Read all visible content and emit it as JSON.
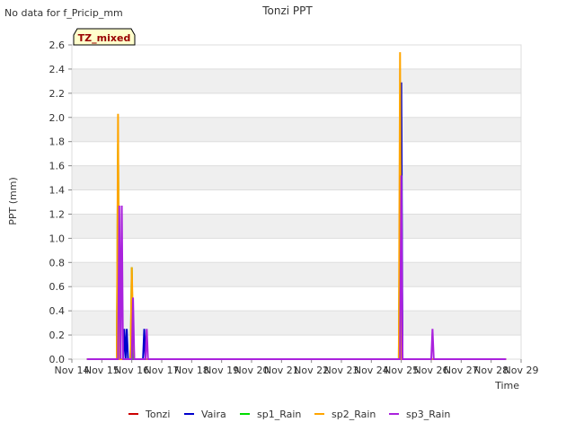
{
  "page": {
    "nodata_note": "No data for f_Pricip_mm"
  },
  "chart_data": {
    "type": "line",
    "title": "Tonzi PPT",
    "xlabel": "Time",
    "ylabel": "PPT (mm)",
    "badge": "TZ_mixed",
    "xlim": [
      "2016-11-14",
      "2016-11-29"
    ],
    "ylim": [
      0,
      2.6
    ],
    "yticks": [
      "0.0",
      "0.2",
      "0.4",
      "0.6",
      "0.8",
      "1.0",
      "1.2",
      "1.4",
      "1.6",
      "1.8",
      "2.0",
      "2.2",
      "2.4",
      "2.6"
    ],
    "xticks": [
      "Nov 14",
      "Nov 15",
      "Nov 16",
      "Nov 17",
      "Nov 18",
      "Nov 19",
      "Nov 20",
      "Nov 21",
      "Nov 22",
      "Nov 23",
      "Nov 24",
      "Nov 25",
      "Nov 26",
      "Nov 27",
      "Nov 28",
      "Nov 29"
    ],
    "grid": true,
    "legend": "bottom",
    "series": [
      {
        "name": "Tonzi",
        "color": "#cc0000",
        "points": [
          [
            "2016-11-14 12:00",
            0
          ],
          [
            "2016-11-15 12:00",
            0
          ],
          [
            "2016-11-15 13:00",
            1.27
          ],
          [
            "2016-11-15 14:00",
            0
          ],
          [
            "2016-11-15 23:00",
            0
          ],
          [
            "2016-11-16 00:00",
            0.51
          ],
          [
            "2016-11-16 01:00",
            0
          ],
          [
            "2016-11-24 23:00",
            0
          ],
          [
            "2016-11-25 00:00",
            0.25
          ],
          [
            "2016-11-25 01:00",
            0
          ],
          [
            "2016-11-28 12:00",
            0
          ]
        ]
      },
      {
        "name": "Vaira",
        "color": "#0000cc",
        "points": [
          [
            "2016-11-14 12:00",
            0
          ],
          [
            "2016-11-15 13:00",
            0
          ],
          [
            "2016-11-15 14:00",
            1.02
          ],
          [
            "2016-11-15 15:00",
            0
          ],
          [
            "2016-11-15 17:00",
            0
          ],
          [
            "2016-11-15 18:00",
            0.25
          ],
          [
            "2016-11-15 19:00",
            0
          ],
          [
            "2016-11-15 20:00",
            0.25
          ],
          [
            "2016-11-15 21:00",
            0
          ],
          [
            "2016-11-16 09:00",
            0
          ],
          [
            "2016-11-16 10:00",
            0.25
          ],
          [
            "2016-11-16 11:00",
            0
          ],
          [
            "2016-11-24 23:00",
            0
          ],
          [
            "2016-11-25 00:00",
            2.29
          ],
          [
            "2016-11-25 01:00",
            0
          ],
          [
            "2016-11-28 12:00",
            0
          ]
        ]
      },
      {
        "name": "sp1_Rain",
        "color": "#00dd00",
        "points": [
          [
            "2016-11-14 12:00",
            0
          ],
          [
            "2016-11-15 12:00",
            0
          ],
          [
            "2016-11-15 13:00",
            1.78
          ],
          [
            "2016-11-15 14:00",
            0
          ],
          [
            "2016-11-15 23:00",
            0
          ],
          [
            "2016-11-16 00:00",
            0.76
          ],
          [
            "2016-11-16 01:00",
            0
          ],
          [
            "2016-11-24 22:00",
            0
          ],
          [
            "2016-11-24 23:00",
            1.52
          ],
          [
            "2016-11-25 00:00",
            0
          ],
          [
            "2016-11-28 12:00",
            0
          ]
        ]
      },
      {
        "name": "sp2_Rain",
        "color": "#ffa500",
        "points": [
          [
            "2016-11-14 12:00",
            0
          ],
          [
            "2016-11-15 12:00",
            0
          ],
          [
            "2016-11-15 13:00",
            2.03
          ],
          [
            "2016-11-15 14:00",
            0
          ],
          [
            "2016-11-15 23:00",
            0
          ],
          [
            "2016-11-16 00:00",
            0.76
          ],
          [
            "2016-11-16 01:00",
            0.25
          ],
          [
            "2016-11-16 02:00",
            0
          ],
          [
            "2016-11-24 22:00",
            0
          ],
          [
            "2016-11-24 23:00",
            2.54
          ],
          [
            "2016-11-25 00:00",
            0
          ],
          [
            "2016-11-28 12:00",
            0
          ]
        ]
      },
      {
        "name": "sp3_Rain",
        "color": "#aa22dd",
        "points": [
          [
            "2016-11-14 12:00",
            0
          ],
          [
            "2016-11-15 13:00",
            0
          ],
          [
            "2016-11-15 14:00",
            1.27
          ],
          [
            "2016-11-15 15:00",
            0
          ],
          [
            "2016-11-15 16:00",
            1.27
          ],
          [
            "2016-11-15 17:00",
            0
          ],
          [
            "2016-11-16 00:00",
            0
          ],
          [
            "2016-11-16 01:00",
            0.51
          ],
          [
            "2016-11-16 02:00",
            0
          ],
          [
            "2016-11-16 11:00",
            0
          ],
          [
            "2016-11-16 12:00",
            0.25
          ],
          [
            "2016-11-16 13:00",
            0
          ],
          [
            "2016-11-24 23:00",
            0
          ],
          [
            "2016-11-25 00:00",
            1.52
          ],
          [
            "2016-11-25 01:00",
            0
          ],
          [
            "2016-11-26 00:00",
            0
          ],
          [
            "2016-11-26 01:00",
            0.25
          ],
          [
            "2016-11-26 02:00",
            0
          ],
          [
            "2016-11-28 12:00",
            0
          ]
        ]
      }
    ]
  }
}
